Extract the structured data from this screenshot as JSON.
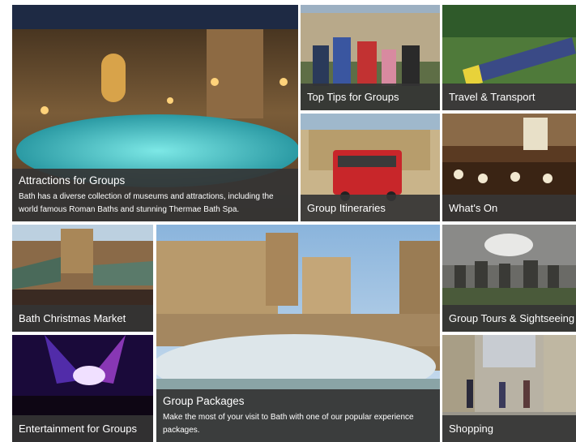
{
  "tiles": {
    "attractions": {
      "title": "Attractions for Groups",
      "description": "Bath has a diverse collection of museums and attractions, including the world famous Roman Baths and stunning Thermae Bath Spa."
    },
    "top_tips": {
      "title": "Top Tips for Groups"
    },
    "travel": {
      "title": "Travel & Transport"
    },
    "itineraries": {
      "title": "Group Itineraries"
    },
    "whats_on": {
      "title": "What's On"
    },
    "christmas_market": {
      "title": "Bath Christmas Market"
    },
    "tours": {
      "title": "Group Tours & Sightseeing"
    },
    "packages": {
      "title": "Group Packages",
      "description": "Make the most of your visit to Bath with one of our popular experience packages."
    },
    "entertainment": {
      "title": "Entertainment for Groups"
    },
    "shopping": {
      "title": "Shopping"
    }
  },
  "colors": {
    "caption_bg": "#343434",
    "caption_text": "#ffffff",
    "page_bg": "#ffffff"
  }
}
